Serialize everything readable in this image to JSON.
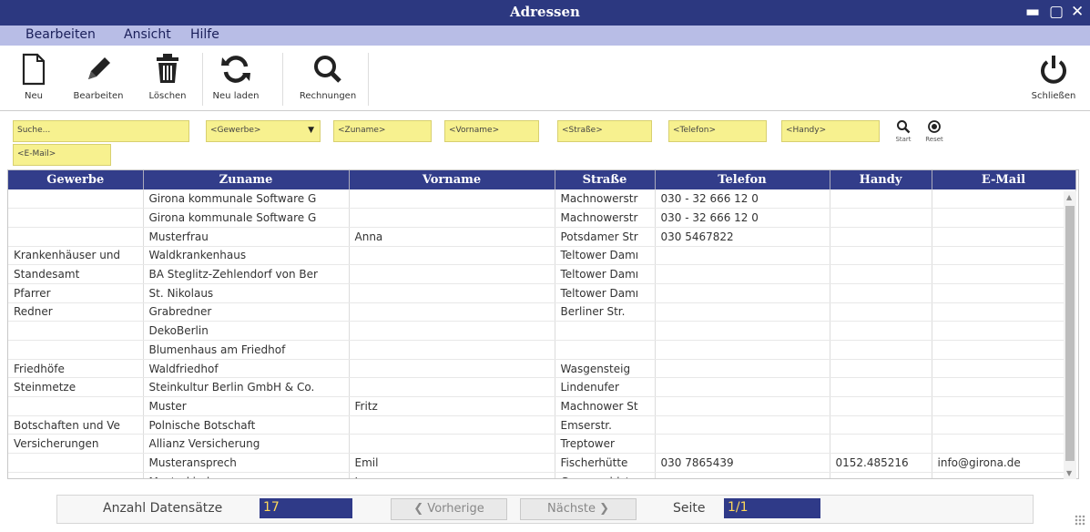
{
  "window": {
    "title": "Adressen",
    "controls": [
      "▬",
      "▢",
      "✕"
    ]
  },
  "menu": [
    "Bearbeiten",
    "Ansicht",
    "Hilfe"
  ],
  "toolbar": {
    "new": "Neu",
    "edit": "Bearbeiten",
    "delete": "Löschen",
    "reload": "Neu laden",
    "invoices": "Rechnungen",
    "close": "Schließen"
  },
  "filters": {
    "search": "Suche...",
    "gewerbe": "<Gewerbe>",
    "zuname": "<Zuname>",
    "vorname": "<Vorname>",
    "strasse": "<Straße>",
    "telefon": "<Telefon>",
    "handy": "<Handy>",
    "email": "<E-Mail>",
    "start": "Start",
    "reset": "Reset"
  },
  "table": {
    "columns": [
      "Gewerbe",
      "Zuname",
      "Vorname",
      "Straße",
      "Telefon",
      "Handy",
      "E-Mail"
    ],
    "rows": [
      [
        "",
        "Girona kommunale Software G",
        "",
        "Machnowerstr",
        "030 - 32 666 12 0",
        "",
        ""
      ],
      [
        "",
        "Girona kommunale Software G",
        "",
        "Machnowerstr",
        "030 - 32 666 12 0",
        "",
        ""
      ],
      [
        "",
        "Musterfrau",
        "Anna",
        "Potsdamer Str",
        "030 5467822",
        "",
        ""
      ],
      [
        "Krankenhäuser und",
        "Waldkrankenhaus",
        "",
        "Teltower Damı",
        "",
        "",
        ""
      ],
      [
        "Standesamt",
        "BA Steglitz-Zehlendorf von Ber",
        "",
        "Teltower Damı",
        "",
        "",
        ""
      ],
      [
        "Pfarrer",
        "St. Nikolaus",
        "",
        "Teltower Damı",
        "",
        "",
        ""
      ],
      [
        "Redner",
        "Grabredner",
        "",
        "Berliner Str.",
        "",
        "",
        ""
      ],
      [
        "",
        "DekoBerlin",
        "",
        "",
        "",
        "",
        ""
      ],
      [
        "",
        "Blumenhaus am Friedhof",
        "",
        "",
        "",
        "",
        ""
      ],
      [
        "Friedhöfe",
        "Waldfriedhof",
        "",
        "Wasgensteig",
        "",
        "",
        ""
      ],
      [
        "Steinmetze",
        "Steinkultur Berlin GmbH & Co.",
        "",
        "Lindenufer",
        "",
        "",
        ""
      ],
      [
        "",
        "Muster",
        "Fritz",
        "Machnower St",
        "",
        "",
        ""
      ],
      [
        "Botschaften und Ve",
        "Polnische Botschaft",
        "",
        "Emserstr.",
        "",
        "",
        ""
      ],
      [
        "Versicherungen",
        "Allianz Versicherung",
        "",
        "Treptower",
        "",
        "",
        ""
      ],
      [
        "",
        "Musteransprech",
        "Emil",
        "Fischerhütte",
        "030 7865439",
        "0152.485216",
        "info@girona.de"
      ],
      [
        "",
        "Musterkind",
        "Jana",
        "Grunewaldstr",
        "",
        "",
        ""
      ]
    ]
  },
  "footer": {
    "count_label": "Anzahl Datensätze",
    "count_value": "17",
    "prev": "❮ Vorherige",
    "next": "Nächste ❯",
    "page_label": "Seite",
    "page_value": "1/1"
  },
  "colors": {
    "titlebar": "#2c3880",
    "menubar": "#b8bde6",
    "header": "#323d8a",
    "filter": "#f7f18f",
    "highlight": "#ffd95a"
  }
}
